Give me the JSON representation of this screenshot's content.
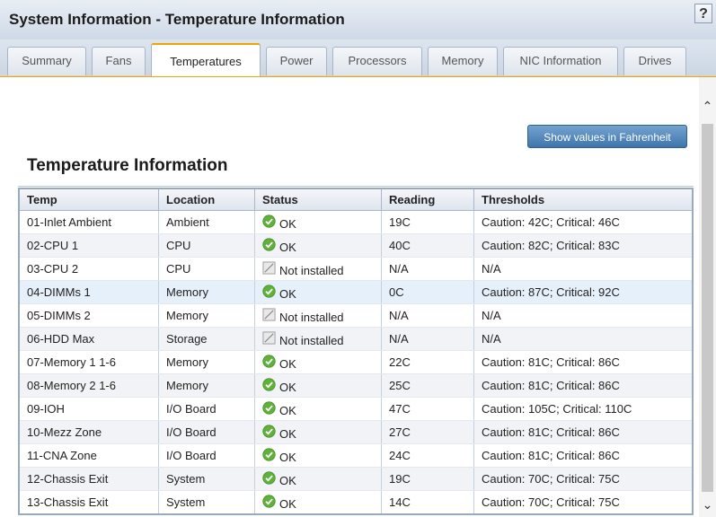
{
  "window": {
    "title": "System Information - Temperature Information",
    "help_label": "?"
  },
  "tabs": [
    {
      "label": "Summary"
    },
    {
      "label": "Fans"
    },
    {
      "label": "Temperatures"
    },
    {
      "label": "Power"
    },
    {
      "label": "Processors"
    },
    {
      "label": "Memory"
    },
    {
      "label": "NIC Information"
    },
    {
      "label": "Drives"
    }
  ],
  "active_tab": "Temperatures",
  "toolbar": {
    "fahrenheit_label": "Show values in Fahrenheit"
  },
  "section": {
    "title": "Temperature Information"
  },
  "table": {
    "headers": [
      "Temp",
      "Location",
      "Status",
      "Reading",
      "Thresholds"
    ],
    "rows": [
      {
        "temp": "01-Inlet Ambient",
        "location": "Ambient",
        "status": "OK",
        "icon": "ok-check-icon",
        "reading": "19C",
        "thresholds": "Caution: 42C; Critical: 46C"
      },
      {
        "temp": "02-CPU 1",
        "location": "CPU",
        "status": "OK",
        "icon": "ok-check-icon",
        "reading": "40C",
        "thresholds": "Caution: 82C; Critical: 83C"
      },
      {
        "temp": "03-CPU 2",
        "location": "CPU",
        "status": "Not installed",
        "icon": "not-installed-icon",
        "reading": "N/A",
        "thresholds": "N/A"
      },
      {
        "temp": "04-DIMMs 1",
        "location": "Memory",
        "status": "OK",
        "icon": "ok-check-icon",
        "reading": "0C",
        "thresholds": "Caution: 87C; Critical: 92C"
      },
      {
        "temp": "05-DIMMs 2",
        "location": "Memory",
        "status": "Not installed",
        "icon": "not-installed-icon",
        "reading": "N/A",
        "thresholds": "N/A"
      },
      {
        "temp": "06-HDD Max",
        "location": "Storage",
        "status": "Not installed",
        "icon": "not-installed-icon",
        "reading": "N/A",
        "thresholds": "N/A"
      },
      {
        "temp": "07-Memory 1 1-6",
        "location": "Memory",
        "status": "OK",
        "icon": "ok-check-icon",
        "reading": "22C",
        "thresholds": "Caution: 81C; Critical: 86C"
      },
      {
        "temp": "08-Memory 2 1-6",
        "location": "Memory",
        "status": "OK",
        "icon": "ok-check-icon",
        "reading": "25C",
        "thresholds": "Caution: 81C; Critical: 86C"
      },
      {
        "temp": "09-IOH",
        "location": "I/O Board",
        "status": "OK",
        "icon": "ok-check-icon",
        "reading": "47C",
        "thresholds": "Caution: 105C; Critical: 110C"
      },
      {
        "temp": "10-Mezz Zone",
        "location": "I/O Board",
        "status": "OK",
        "icon": "ok-check-icon",
        "reading": "27C",
        "thresholds": "Caution: 81C; Critical: 86C"
      },
      {
        "temp": "11-CNA Zone",
        "location": "I/O Board",
        "status": "OK",
        "icon": "ok-check-icon",
        "reading": "24C",
        "thresholds": "Caution: 81C; Critical: 86C"
      },
      {
        "temp": "12-Chassis Exit",
        "location": "System",
        "status": "OK",
        "icon": "ok-check-icon",
        "reading": "19C",
        "thresholds": "Caution: 70C; Critical: 75C"
      },
      {
        "temp": "13-Chassis Exit",
        "location": "System",
        "status": "OK",
        "icon": "ok-check-icon",
        "reading": "14C",
        "thresholds": "Caution: 70C; Critical: 75C"
      }
    ],
    "highlighted_row": "04-DIMMs 1"
  },
  "colors": {
    "ok_green": "#5fb13a",
    "accent_orange": "#f0a400",
    "button_blue": "#4a80b6"
  }
}
